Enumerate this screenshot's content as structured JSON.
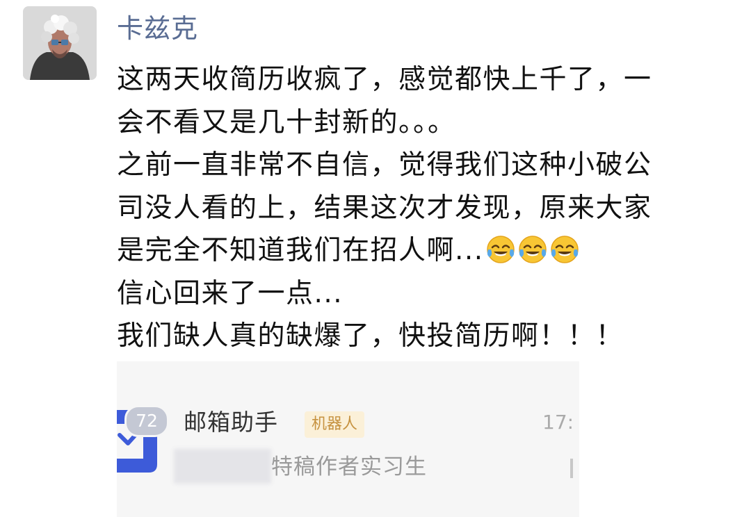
{
  "post": {
    "author": "卡兹克",
    "author_color": "#596c93",
    "lines": [
      "这两天收简历收疯了，感觉都快上千了，一",
      "会不看又是几十封新的。。。",
      "之前一直非常不自信，觉得我们这种小破公",
      "司没人看的上，结果这次才发现，原来大家",
      "是完全不知道我们在招人啊...",
      "信心回来了一点...",
      "我们缺人真的缺爆了，快投简历啊！！！"
    ],
    "emoji_icons": [
      "tears-of-joy-emoji",
      "tears-of-joy-emoji",
      "tears-of-joy-emoji"
    ]
  },
  "screenshot": {
    "unread_count": "72",
    "sender": "邮箱助手",
    "tag": "机器人",
    "time": "17:",
    "preview": "特稿作者实习生",
    "icon": "mail-check-icon",
    "accent": "#3d5bd9"
  }
}
